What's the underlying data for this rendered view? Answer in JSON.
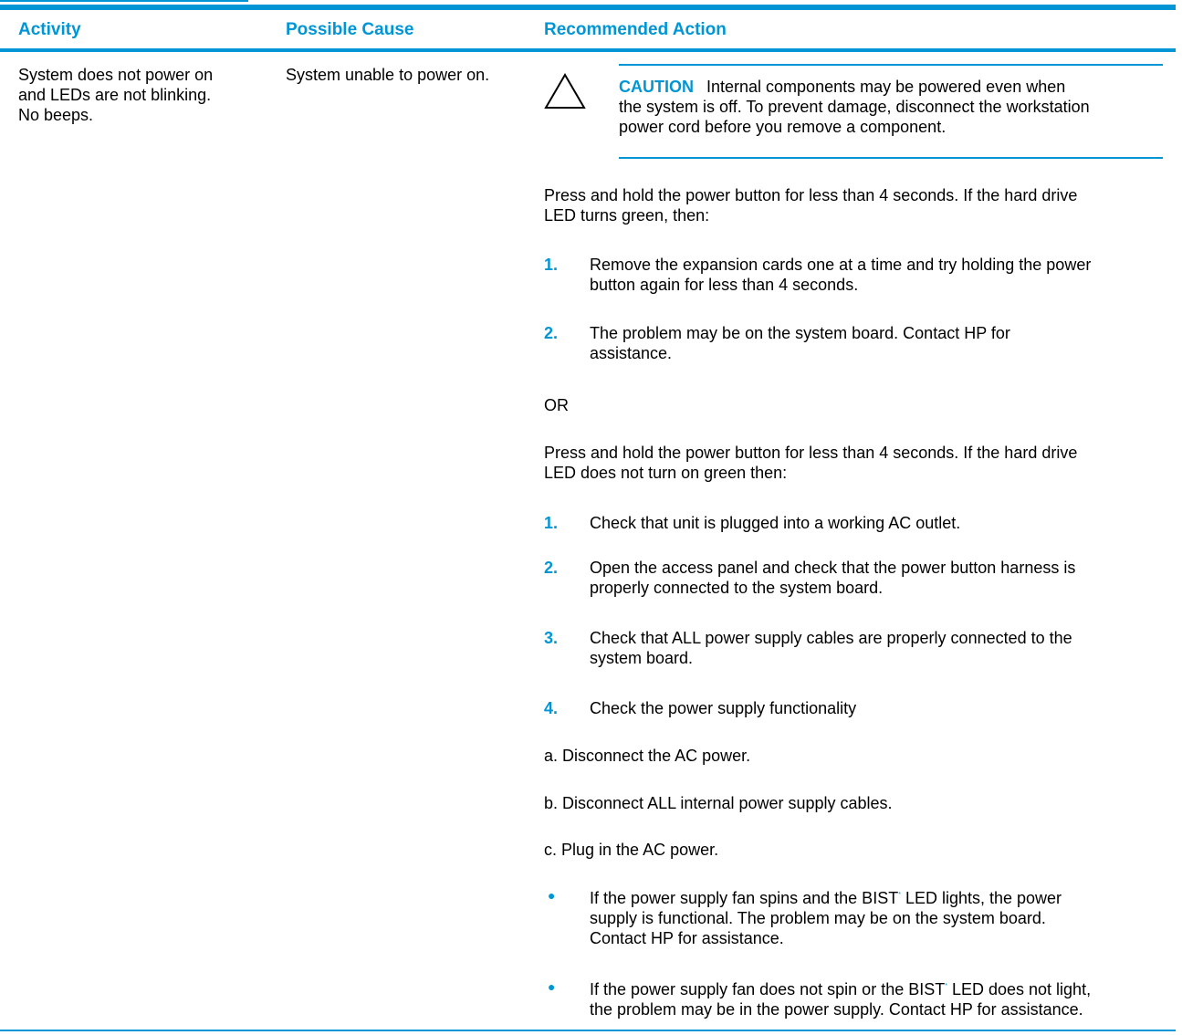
{
  "colors": {
    "accent": "#0096d6",
    "text": "#000000"
  },
  "table": {
    "headers": [
      "Activity",
      "Possible Cause",
      "Recommended Action"
    ],
    "activity": [
      "System does not power on",
      "and LEDs are not blinking.",
      "No beeps."
    ],
    "cause": "System unable to power on.",
    "caution": {
      "icon": "caution-triangle-icon",
      "label": "CAUTION",
      "lines": [
        "Internal components may be powered even when",
        "the system is off. To prevent damage, disconnect the workstation",
        "power cord before you remove a component."
      ]
    },
    "intro1": [
      "Press and hold the power button for less than 4 seconds. If the hard drive",
      "LED turns green, then:"
    ],
    "steps1": [
      {
        "num": "1.",
        "lines": [
          "Remove the expansion cards one at a time and try holding the power",
          "button again for less than 4 seconds."
        ]
      },
      {
        "num": "2.",
        "lines": [
          "The problem may be on the system board. Contact HP for",
          "assistance."
        ]
      }
    ],
    "or": "OR",
    "intro2": [
      "Press and hold the power button for less than 4 seconds. If the hard drive",
      "LED does not turn on green then:"
    ],
    "steps2": [
      {
        "num": "1.",
        "lines": [
          "Check that unit is plugged into a working AC outlet."
        ]
      },
      {
        "num": "2.",
        "lines": [
          "Open the access panel and check that the power button harness is",
          "properly connected to the system board."
        ]
      },
      {
        "num": "3.",
        "lines": [
          "Check that ALL power supply cables are properly connected to the",
          "system board."
        ]
      },
      {
        "num": "4.",
        "lines": [
          "Check the power supply functionality"
        ]
      }
    ],
    "substeps": [
      "a. Disconnect the AC power.",
      "b. Disconnect ALL internal power supply cables.",
      "c. Plug in the AC power."
    ],
    "bullets": [
      {
        "lead": "If the power supply fan spins and the BIST",
        "sup": "*",
        "rest": " LED lights, the power",
        "lines": [
          "supply is functional. The problem may be on the system board.",
          "Contact HP for assistance."
        ]
      },
      {
        "lead": "If the power supply fan does not spin or the BIST",
        "sup": "*",
        "rest": " LED does not light,",
        "lines": [
          "the problem may be in the power supply. Contact HP for assistance."
        ]
      }
    ]
  }
}
